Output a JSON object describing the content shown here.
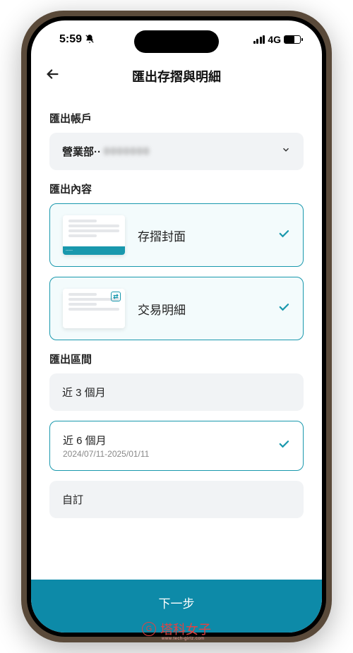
{
  "status": {
    "time": "5:59",
    "network": "4G"
  },
  "header": {
    "title": "匯出存摺與明細"
  },
  "account": {
    "section_label": "匯出帳戶",
    "branch_prefix": "營業部··"
  },
  "content": {
    "section_label": "匯出內容",
    "options": [
      {
        "label": "存摺封面"
      },
      {
        "label": "交易明細"
      }
    ]
  },
  "range": {
    "section_label": "匯出區間",
    "options": {
      "three_month": "近 3 個月",
      "six_month": "近 6 個月",
      "six_month_dates": "2024/07/11-2025/01/11",
      "custom": "自訂"
    }
  },
  "footer": {
    "next": "下一步"
  },
  "watermark": {
    "text": "塔科女子",
    "sub": "www.tech-girlz.com"
  }
}
